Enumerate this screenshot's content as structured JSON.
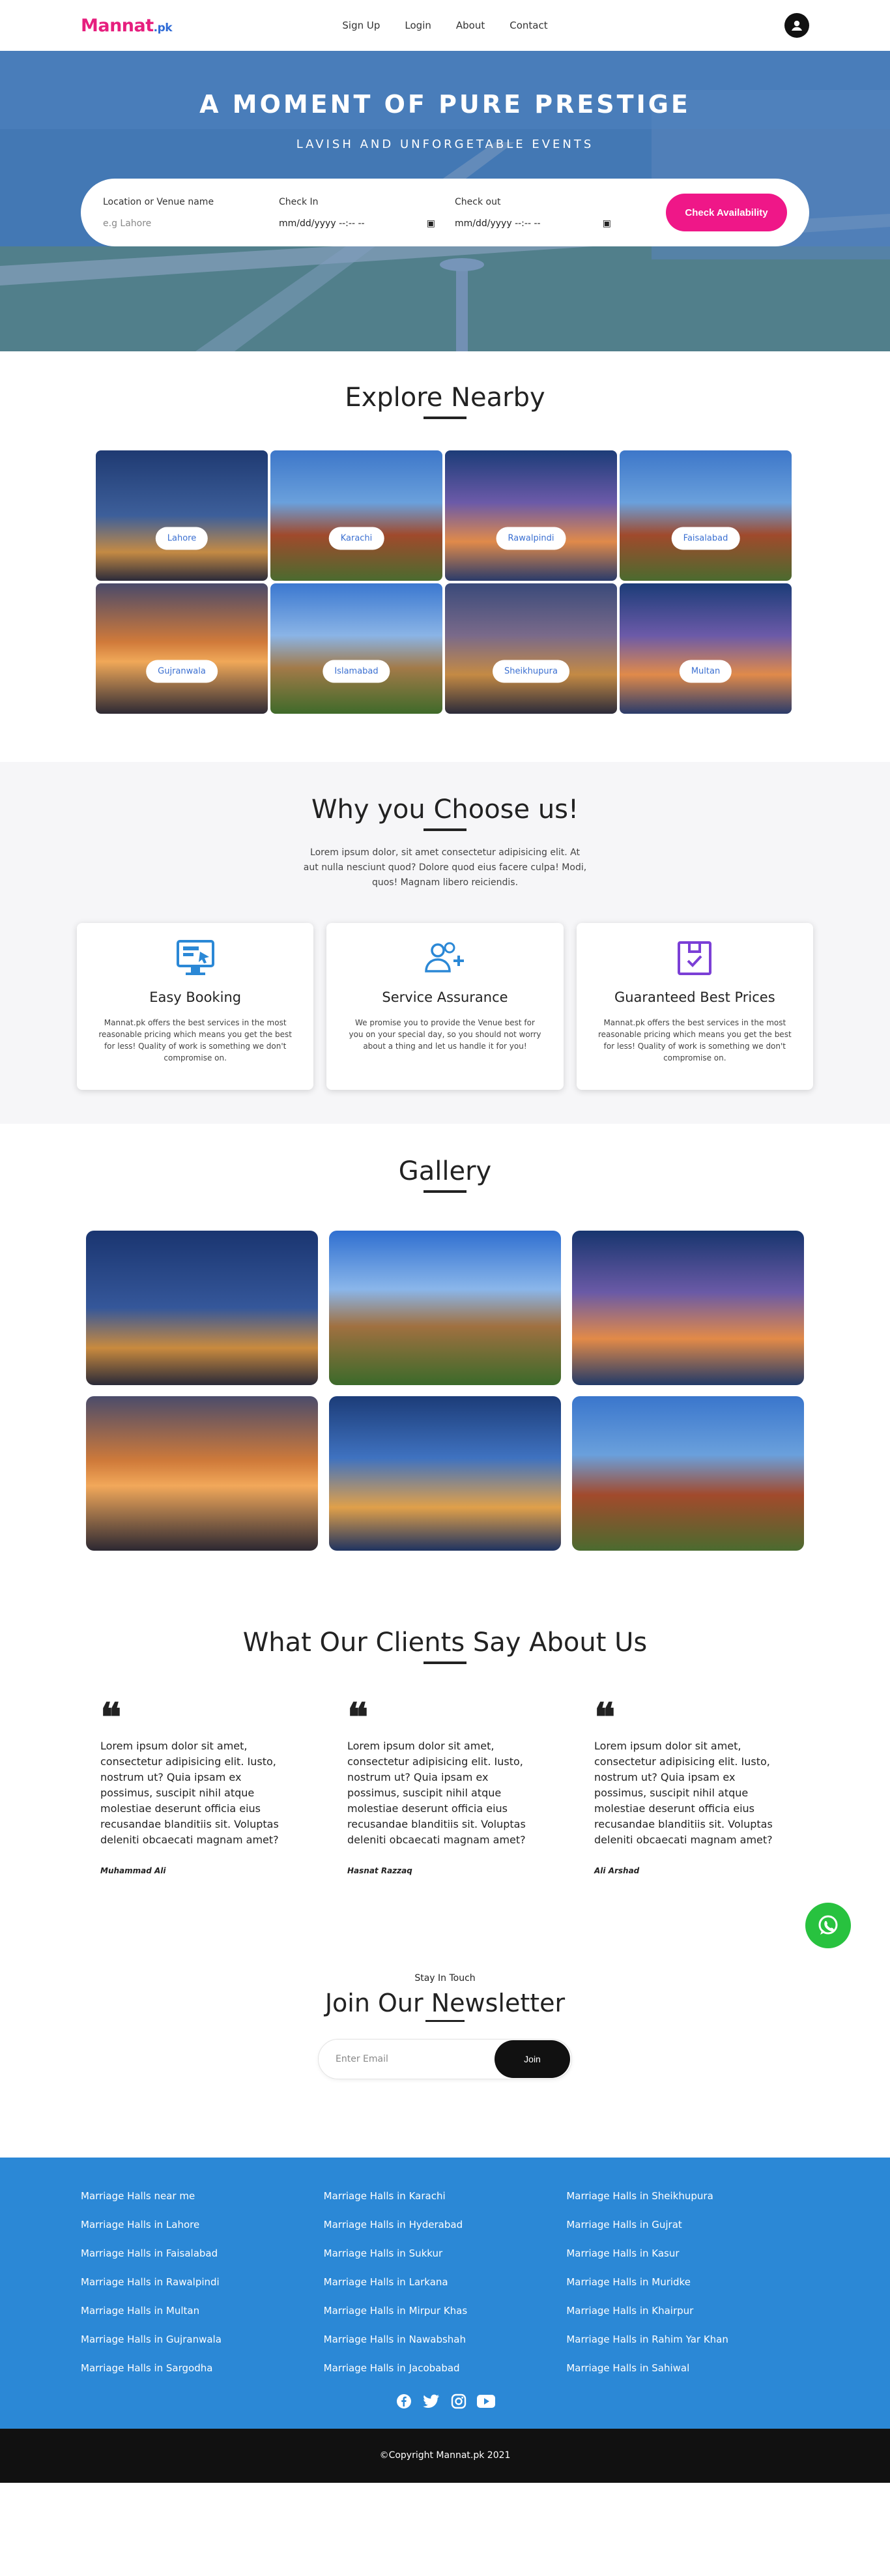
{
  "header": {
    "logo_main": "Mannat",
    "logo_suffix": ".pk",
    "nav": [
      "Sign Up",
      "Login",
      "About",
      "Contact"
    ],
    "profile_icon": "user-circle-icon"
  },
  "hero": {
    "title": "A MOMENT OF PURE PRESTIGE",
    "subtitle": "LAVISH AND UNFORGETABLE EVENTS",
    "search": {
      "location_label": "Location or Venue name",
      "location_placeholder": "e.g Lahore",
      "checkin_label": "Check In",
      "checkin_value": "mm/dd/yyyy --:-- --",
      "checkout_label": "Check out",
      "checkout_value": "mm/dd/yyyy --:-- --",
      "button": "Check Availability"
    }
  },
  "explore": {
    "title": "Explore Nearby",
    "cities": [
      "Lahore",
      "Karachi",
      "Rawalpindi",
      "Faisalabad",
      "Gujranwala",
      "Islamabad",
      "Sheikhupura",
      "Multan"
    ]
  },
  "why": {
    "title": "Why you Choose us!",
    "intro": "Lorem ipsum dolor, sit amet consectetur adipisicing elit. At aut nulla nesciunt quod? Dolore quod eius facere culpa! Modi, quos! Magnam libero reiciendis.",
    "cards": [
      {
        "icon": "monitor-cursor-icon",
        "title": "Easy Booking",
        "text": "Mannat.pk offers the best services in the most reasonable pricing which means you get the best for less! Quality of work is something we don't compromise on."
      },
      {
        "icon": "users-add-icon",
        "title": "Service Assurance",
        "text": "We promise you to provide the Venue best for you on your special day, so you should not worry about a thing and let us handle it for you!"
      },
      {
        "icon": "box-check-icon",
        "title": "Guaranteed Best Prices",
        "text": "Mannat.pk offers the best services in the most reasonable pricing which means you get the best for less! Quality of work is something we don't compromise on."
      }
    ]
  },
  "gallery": {
    "title": "Gallery"
  },
  "testimonials": {
    "title": "What Our Clients Say About Us",
    "items": [
      {
        "text": "Lorem ipsum dolor sit amet, consectetur adipisicing elit. Iusto, nostrum ut? Quia ipsam ex possimus, suscipit nihil atque molestiae deserunt officia eius recusandae blanditiis sit. Voluptas deleniti obcaecati magnam amet?",
        "name": "Muhammad Ali"
      },
      {
        "text": "Lorem ipsum dolor sit amet, consectetur adipisicing elit. Iusto, nostrum ut? Quia ipsam ex possimus, suscipit nihil atque molestiae deserunt officia eius recusandae blanditiis sit. Voluptas deleniti obcaecati magnam amet?",
        "name": "Hasnat Razzaq"
      },
      {
        "text": "Lorem ipsum dolor sit amet, consectetur adipisicing elit. Iusto, nostrum ut? Quia ipsam ex possimus, suscipit nihil atque molestiae deserunt officia eius recusandae blanditiis sit. Voluptas deleniti obcaecati magnam amet?",
        "name": "Ali Arshad"
      }
    ]
  },
  "newsletter": {
    "kicker": "Stay In Touch",
    "title": "Join Our Newsletter",
    "placeholder": "Enter Email",
    "button": "Join"
  },
  "footer": {
    "columns": [
      [
        "Marriage Halls near me",
        "Marriage Halls in Lahore",
        "Marriage Halls in Faisalabad",
        "Marriage Halls in Rawalpindi",
        "Marriage Halls in Multan",
        "Marriage Halls in Gujranwala",
        "Marriage Halls in Sargodha"
      ],
      [
        "Marriage Halls in Karachi",
        "Marriage Halls in Hyderabad",
        "Marriage Halls in Sukkur",
        "Marriage Halls in Larkana",
        "Marriage Halls in Mirpur Khas",
        "Marriage Halls in Nawabshah",
        "Marriage Halls in Jacobabad"
      ],
      [
        "Marriage Halls in Sheikhupura",
        "Marriage Halls in Gujrat",
        "Marriage Halls in Kasur",
        "Marriage Halls in Muridke",
        "Marriage Halls in Khairpur",
        "Marriage Halls in Rahim Yar Khan",
        "Marriage Halls in Sahiwal"
      ]
    ],
    "social": [
      "facebook-icon",
      "twitter-icon",
      "instagram-icon",
      "youtube-icon"
    ],
    "copyright": "©Copyright Mannat.pk 2021"
  },
  "colors": {
    "brand_pink": "#ef1788",
    "brand_blue": "#2f6bd6",
    "footer_blue": "#2b88d6",
    "whatsapp": "#28c23f"
  }
}
